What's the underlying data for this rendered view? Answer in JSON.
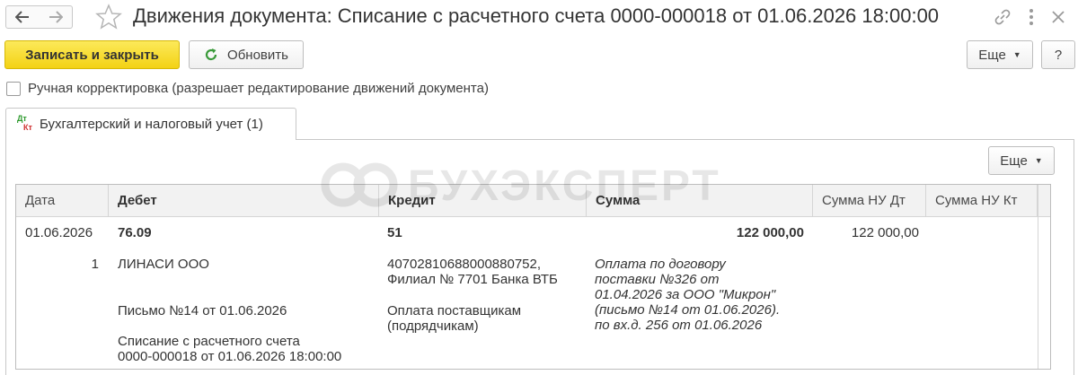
{
  "window": {
    "title": "Движения документа: Списание с расчетного счета 0000-000018 от 01.06.2026 18:00:00"
  },
  "toolbar": {
    "save_close": "Записать и закрыть",
    "refresh": "Обновить",
    "more": "Еще",
    "help": "?"
  },
  "manual_edit": {
    "label": "Ручная корректировка (разрешает редактирование движений документа)",
    "checked": false
  },
  "tab": {
    "icon_top": "Дт",
    "icon_bottom": "Кт",
    "label": "Бухгалтерский и налоговый учет (1)"
  },
  "panel": {
    "more": "Еще"
  },
  "watermark": "БУХЭКСПЕРТ",
  "table": {
    "columns": [
      "Дата",
      "Дебет",
      "Кредит",
      "Сумма",
      "Сумма НУ Дт",
      "Сумма НУ Кт"
    ],
    "row": {
      "date": "01.06.2026",
      "number": "1",
      "debit_account": "76.09",
      "debit_subconto1": "ЛИНАСИ ООО",
      "debit_subconto2": "Письмо №14 от 01.06.2026",
      "debit_subconto3_line1": "Списание с расчетного счета",
      "debit_subconto3_line2": "0000-000018 от 01.06.2026 18:00:00",
      "credit_account": "51",
      "credit_subconto1_line1": "40702810688000880752,",
      "credit_subconto1_line2": "Филиал № 7701 Банка ВТБ",
      "credit_subconto2_line1": "Оплата поставщикам",
      "credit_subconto2_line2": "(подрядчикам)",
      "amount": "122 000,00",
      "content_line1": "Оплата по договору",
      "content_line2": "поставки №326 от",
      "content_line3": "01.04.2026 за ООО \"Микрон\"",
      "content_line4": "(письмо №14 от 01.06.2026).",
      "content_line5": "по вх.д. 256 от 01.06.2026",
      "amount_nu_dt": "122 000,00",
      "amount_nu_kt": ""
    }
  }
}
